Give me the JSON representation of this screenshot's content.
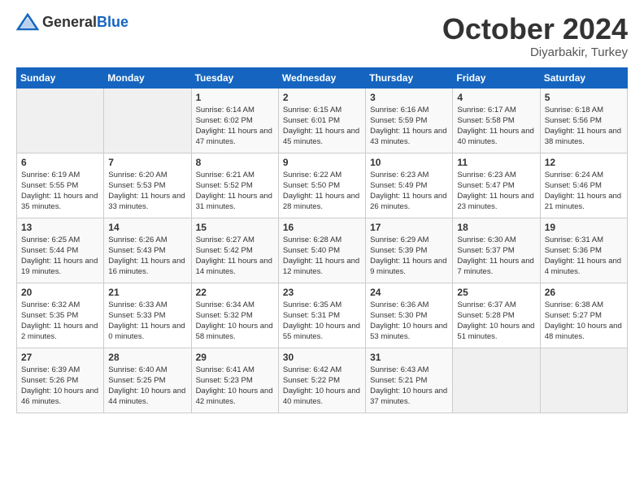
{
  "header": {
    "logo_general": "General",
    "logo_blue": "Blue",
    "month_title": "October 2024",
    "subtitle": "Diyarbakir, Turkey"
  },
  "days_of_week": [
    "Sunday",
    "Monday",
    "Tuesday",
    "Wednesday",
    "Thursday",
    "Friday",
    "Saturday"
  ],
  "weeks": [
    [
      {
        "day": "",
        "info": ""
      },
      {
        "day": "",
        "info": ""
      },
      {
        "day": "1",
        "sunrise": "Sunrise: 6:14 AM",
        "sunset": "Sunset: 6:02 PM",
        "daylight": "Daylight: 11 hours and 47 minutes."
      },
      {
        "day": "2",
        "sunrise": "Sunrise: 6:15 AM",
        "sunset": "Sunset: 6:01 PM",
        "daylight": "Daylight: 11 hours and 45 minutes."
      },
      {
        "day": "3",
        "sunrise": "Sunrise: 6:16 AM",
        "sunset": "Sunset: 5:59 PM",
        "daylight": "Daylight: 11 hours and 43 minutes."
      },
      {
        "day": "4",
        "sunrise": "Sunrise: 6:17 AM",
        "sunset": "Sunset: 5:58 PM",
        "daylight": "Daylight: 11 hours and 40 minutes."
      },
      {
        "day": "5",
        "sunrise": "Sunrise: 6:18 AM",
        "sunset": "Sunset: 5:56 PM",
        "daylight": "Daylight: 11 hours and 38 minutes."
      }
    ],
    [
      {
        "day": "6",
        "sunrise": "Sunrise: 6:19 AM",
        "sunset": "Sunset: 5:55 PM",
        "daylight": "Daylight: 11 hours and 35 minutes."
      },
      {
        "day": "7",
        "sunrise": "Sunrise: 6:20 AM",
        "sunset": "Sunset: 5:53 PM",
        "daylight": "Daylight: 11 hours and 33 minutes."
      },
      {
        "day": "8",
        "sunrise": "Sunrise: 6:21 AM",
        "sunset": "Sunset: 5:52 PM",
        "daylight": "Daylight: 11 hours and 31 minutes."
      },
      {
        "day": "9",
        "sunrise": "Sunrise: 6:22 AM",
        "sunset": "Sunset: 5:50 PM",
        "daylight": "Daylight: 11 hours and 28 minutes."
      },
      {
        "day": "10",
        "sunrise": "Sunrise: 6:23 AM",
        "sunset": "Sunset: 5:49 PM",
        "daylight": "Daylight: 11 hours and 26 minutes."
      },
      {
        "day": "11",
        "sunrise": "Sunrise: 6:23 AM",
        "sunset": "Sunset: 5:47 PM",
        "daylight": "Daylight: 11 hours and 23 minutes."
      },
      {
        "day": "12",
        "sunrise": "Sunrise: 6:24 AM",
        "sunset": "Sunset: 5:46 PM",
        "daylight": "Daylight: 11 hours and 21 minutes."
      }
    ],
    [
      {
        "day": "13",
        "sunrise": "Sunrise: 6:25 AM",
        "sunset": "Sunset: 5:44 PM",
        "daylight": "Daylight: 11 hours and 19 minutes."
      },
      {
        "day": "14",
        "sunrise": "Sunrise: 6:26 AM",
        "sunset": "Sunset: 5:43 PM",
        "daylight": "Daylight: 11 hours and 16 minutes."
      },
      {
        "day": "15",
        "sunrise": "Sunrise: 6:27 AM",
        "sunset": "Sunset: 5:42 PM",
        "daylight": "Daylight: 11 hours and 14 minutes."
      },
      {
        "day": "16",
        "sunrise": "Sunrise: 6:28 AM",
        "sunset": "Sunset: 5:40 PM",
        "daylight": "Daylight: 11 hours and 12 minutes."
      },
      {
        "day": "17",
        "sunrise": "Sunrise: 6:29 AM",
        "sunset": "Sunset: 5:39 PM",
        "daylight": "Daylight: 11 hours and 9 minutes."
      },
      {
        "day": "18",
        "sunrise": "Sunrise: 6:30 AM",
        "sunset": "Sunset: 5:37 PM",
        "daylight": "Daylight: 11 hours and 7 minutes."
      },
      {
        "day": "19",
        "sunrise": "Sunrise: 6:31 AM",
        "sunset": "Sunset: 5:36 PM",
        "daylight": "Daylight: 11 hours and 4 minutes."
      }
    ],
    [
      {
        "day": "20",
        "sunrise": "Sunrise: 6:32 AM",
        "sunset": "Sunset: 5:35 PM",
        "daylight": "Daylight: 11 hours and 2 minutes."
      },
      {
        "day": "21",
        "sunrise": "Sunrise: 6:33 AM",
        "sunset": "Sunset: 5:33 PM",
        "daylight": "Daylight: 11 hours and 0 minutes."
      },
      {
        "day": "22",
        "sunrise": "Sunrise: 6:34 AM",
        "sunset": "Sunset: 5:32 PM",
        "daylight": "Daylight: 10 hours and 58 minutes."
      },
      {
        "day": "23",
        "sunrise": "Sunrise: 6:35 AM",
        "sunset": "Sunset: 5:31 PM",
        "daylight": "Daylight: 10 hours and 55 minutes."
      },
      {
        "day": "24",
        "sunrise": "Sunrise: 6:36 AM",
        "sunset": "Sunset: 5:30 PM",
        "daylight": "Daylight: 10 hours and 53 minutes."
      },
      {
        "day": "25",
        "sunrise": "Sunrise: 6:37 AM",
        "sunset": "Sunset: 5:28 PM",
        "daylight": "Daylight: 10 hours and 51 minutes."
      },
      {
        "day": "26",
        "sunrise": "Sunrise: 6:38 AM",
        "sunset": "Sunset: 5:27 PM",
        "daylight": "Daylight: 10 hours and 48 minutes."
      }
    ],
    [
      {
        "day": "27",
        "sunrise": "Sunrise: 6:39 AM",
        "sunset": "Sunset: 5:26 PM",
        "daylight": "Daylight: 10 hours and 46 minutes."
      },
      {
        "day": "28",
        "sunrise": "Sunrise: 6:40 AM",
        "sunset": "Sunset: 5:25 PM",
        "daylight": "Daylight: 10 hours and 44 minutes."
      },
      {
        "day": "29",
        "sunrise": "Sunrise: 6:41 AM",
        "sunset": "Sunset: 5:23 PM",
        "daylight": "Daylight: 10 hours and 42 minutes."
      },
      {
        "day": "30",
        "sunrise": "Sunrise: 6:42 AM",
        "sunset": "Sunset: 5:22 PM",
        "daylight": "Daylight: 10 hours and 40 minutes."
      },
      {
        "day": "31",
        "sunrise": "Sunrise: 6:43 AM",
        "sunset": "Sunset: 5:21 PM",
        "daylight": "Daylight: 10 hours and 37 minutes."
      },
      {
        "day": "",
        "info": ""
      },
      {
        "day": "",
        "info": ""
      }
    ]
  ]
}
